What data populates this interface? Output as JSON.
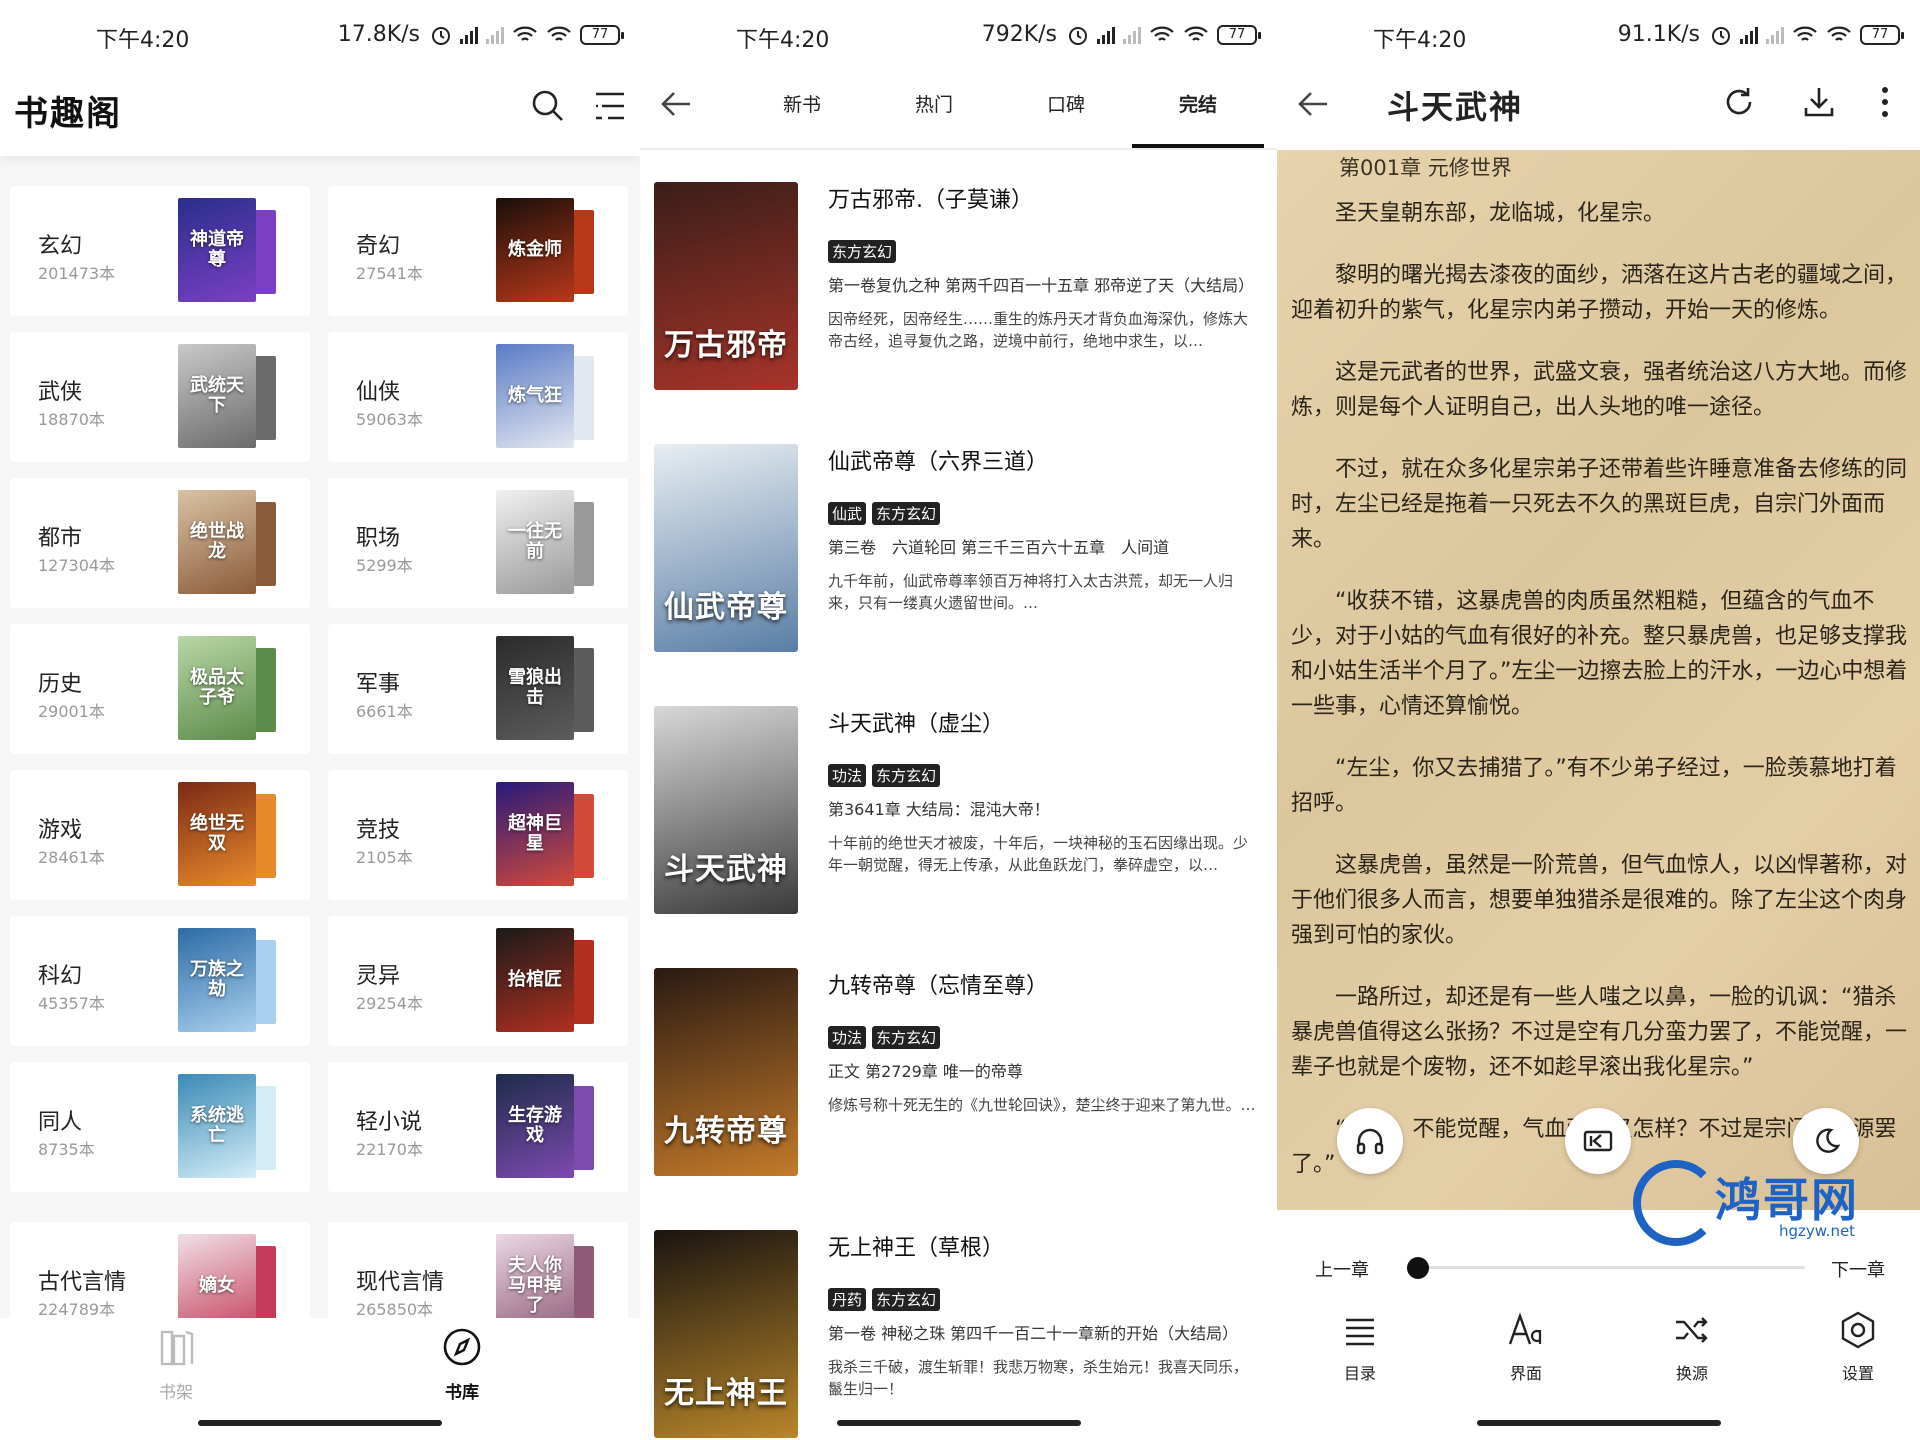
{
  "status_bars": [
    {
      "time": "下午4:20",
      "speed": "17.8K/s",
      "battery": "77"
    },
    {
      "time": "下午4:20",
      "speed": "792K/s",
      "battery": "77"
    },
    {
      "time": "下午4:20",
      "speed": "91.1K/s",
      "battery": "77"
    }
  ],
  "library": {
    "title": "书趣阁",
    "categories": [
      {
        "name": "玄幻",
        "count": "201473本",
        "cover_text": "神道帝尊",
        "colors": [
          "#2a2f8a",
          "#7a3fc4"
        ]
      },
      {
        "name": "奇幻",
        "count": "27541本",
        "cover_text": "炼金师",
        "colors": [
          "#1a0f0a",
          "#b8381a"
        ]
      },
      {
        "name": "武侠",
        "count": "18870本",
        "cover_text": "武统天下",
        "colors": [
          "#c9c9c9",
          "#6b6b6b"
        ]
      },
      {
        "name": "仙侠",
        "count": "59063本",
        "cover_text": "炼气狂",
        "colors": [
          "#5a7bc6",
          "#e3e7f0"
        ]
      },
      {
        "name": "都市",
        "count": "127304本",
        "cover_text": "绝世战龙",
        "colors": [
          "#d8c2a4",
          "#8c5c3a"
        ]
      },
      {
        "name": "职场",
        "count": "5299本",
        "cover_text": "一往无前",
        "colors": [
          "#f0f0f0",
          "#9a9a9a"
        ]
      },
      {
        "name": "历史",
        "count": "29001本",
        "cover_text": "极品太子爷",
        "colors": [
          "#b8d6a6",
          "#5d8c4a"
        ]
      },
      {
        "name": "军事",
        "count": "6661本",
        "cover_text": "雪狼出击",
        "colors": [
          "#2b2b2b",
          "#5c5c5c"
        ]
      },
      {
        "name": "游戏",
        "count": "28461本",
        "cover_text": "绝世无双",
        "colors": [
          "#7a2a16",
          "#e88a2c"
        ]
      },
      {
        "name": "竞技",
        "count": "2105本",
        "cover_text": "超神巨星",
        "colors": [
          "#281a7a",
          "#d24a3a"
        ]
      },
      {
        "name": "科幻",
        "count": "45357本",
        "cover_text": "万族之劫",
        "colors": [
          "#2d6ba6",
          "#a8d0ee"
        ]
      },
      {
        "name": "灵异",
        "count": "29254本",
        "cover_text": "抬棺匠",
        "colors": [
          "#1a1a1a",
          "#b03020"
        ]
      },
      {
        "name": "同人",
        "count": "8735本",
        "cover_text": "系统逃亡",
        "colors": [
          "#3a8ab6",
          "#d4eef8"
        ]
      },
      {
        "name": "轻小说",
        "count": "22170本",
        "cover_text": "生存游戏",
        "colors": [
          "#1e2c4a",
          "#7d4ab0"
        ]
      },
      {
        "name": "古代言情",
        "count": "224789本",
        "cover_text": "嫡女",
        "colors": [
          "#f0e0e6",
          "#c43c5a"
        ]
      },
      {
        "name": "现代言情",
        "count": "265850本",
        "cover_text": "夫人你马甲掉了",
        "colors": [
          "#ecd8e4",
          "#8e5a76"
        ]
      }
    ],
    "nav": {
      "shelf": "书架",
      "store": "书库"
    }
  },
  "ranking": {
    "tabs": [
      "新书",
      "热门",
      "口碑",
      "完结"
    ],
    "active_tab": "完结",
    "books": [
      {
        "title": "万古邪帝.（子莫谦）",
        "tags": [
          "东方玄幻"
        ],
        "latest": "第一卷复仇之种 第两千四百一十五章 邪帝逆了天（大结局）",
        "desc": "因帝经死，因帝经生……重生的炼丹天才背负血海深仇，修炼大帝古经，追寻复仇之路，逆境中前行，绝地中求生，以…",
        "cover_text": "万古邪帝",
        "colors": [
          "#3a1e18",
          "#a8342a"
        ]
      },
      {
        "title": "仙武帝尊（六界三道）",
        "tags": [
          "仙武",
          "东方玄幻"
        ],
        "latest": "第三卷　六道轮回 第三千三百六十五章　人间道",
        "desc": "九千年前，仙武帝尊率领百万神将打入太古洪荒，却无一人归来，只有一缕真火遗留世间。…",
        "cover_text": "仙武帝尊",
        "colors": [
          "#e8eef2",
          "#5a7ea6"
        ]
      },
      {
        "title": "斗天武神（虚尘）",
        "tags": [
          "功法",
          "东方玄幻"
        ],
        "latest": "第3641章 大结局：混沌大帝！",
        "desc": "十年前的绝世天才被废，十年后，一块神秘的玉石因缘出现。少年一朝觉醒，得无上传承，从此鱼跃龙门，拳碎虚空，以…",
        "cover_text": "斗天武神",
        "colors": [
          "#d8d8d8",
          "#3a3a3a"
        ]
      },
      {
        "title": "九转帝尊（忘情至尊）",
        "tags": [
          "功法",
          "东方玄幻"
        ],
        "latest": "正文 第2729章 唯一的帝尊",
        "desc": "修炼号称十死无生的《九世轮回诀》，楚尘终于迎来了第九世。…",
        "cover_text": "九转帝尊",
        "colors": [
          "#2a1a12",
          "#c47a2a"
        ]
      },
      {
        "title": "无上神王（草根）",
        "tags": [
          "丹药",
          "东方玄幻"
        ],
        "latest": "第一卷 神秘之珠 第四千一百二十一章新的开始（大结局）",
        "desc": "我杀三千破，渡生斩罪！我悲万物寒，杀生始元！我喜天同乐，鬣生归一！",
        "cover_text": "无上神王",
        "colors": [
          "#1a1410",
          "#b8862a"
        ]
      }
    ]
  },
  "reader": {
    "title": "斗天武神",
    "chapter_heading": "第001章 元修世界",
    "paragraphs": [
      "圣天皇朝东部，龙临城，化星宗。",
      "黎明的曙光揭去漆夜的面纱，洒落在这片古老的疆域之间，迎着初升的紫气，化星宗内弟子攒动，开始一天的修炼。",
      "这是元武者的世界，武盛文衰，强者统治这八方大地。而修炼，则是每个人证明自己，出人头地的唯一途径。",
      "不过，就在众多化星宗弟子还带着些许睡意准备去修练的同时，左尘已经是拖着一只死去不久的黑斑巨虎，自宗门外面而来。",
      "“收获不错，这暴虎兽的肉质虽然粗糙，但蕴含的气血不少，对于小姑的气血有很好的补充。整只暴虎兽，也足够支撑我和小姑生活半个月了。”左尘一边擦去脸上的汗水，一边心中想着一些事，心情还算愉悦。",
      "“左尘，你又去捕猎了。”有不少弟子经过，一脸羡慕地打着招呼。",
      "这暴虎兽，虽然是一阶荒兽，但气血惊人，以凶悍著称，对于他们很多人而言，想要单独猎杀是很难的。除了左尘这个肉身强到可怕的家伙。",
      "一路所过，却还是有一些人嗤之以鼻，一脸的讥讽：“猎杀暴虎兽值得这么张扬？不过是空有几分蛮力罢了，不能觉醒，一辈子也就是个废物，还不如趁早滚出我化星宗。”",
      "“蛮力，不能觉醒，气血强大又怎样？不过是宗门的资源罢了。”"
    ],
    "prev_chapter": "上一章",
    "next_chapter": "下一章",
    "progress": 0.0,
    "controls": [
      "目录",
      "界面",
      "换源",
      "设置"
    ]
  },
  "watermark": {
    "text": "鸿哥网",
    "url": "hgzyw.net"
  }
}
